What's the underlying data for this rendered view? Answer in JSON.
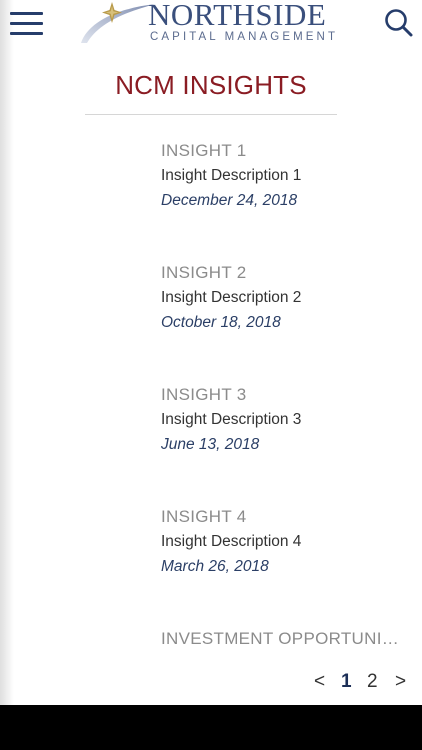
{
  "header": {
    "logo_name": "NORTHSIDE",
    "logo_subtitle": "CAPITAL MANAGEMENT",
    "menu_icon": "hamburger-menu-icon",
    "search_icon": "search-icon",
    "brand_color": "#263d6b"
  },
  "page": {
    "title": "NCM INSIGHTS",
    "title_color": "#8a1c23"
  },
  "insights": [
    {
      "title": "INSIGHT 1",
      "description": "Insight Description 1",
      "date": "December 24, 2018"
    },
    {
      "title": "INSIGHT 2",
      "description": "Insight Description 2",
      "date": "October 18, 2018"
    },
    {
      "title": "INSIGHT 3",
      "description": "Insight Description 3",
      "date": "June 13, 2018"
    },
    {
      "title": "INSIGHT 4",
      "description": "Insight Description 4",
      "date": "March 26, 2018"
    },
    {
      "title": "INVESTMENT OPPORTUNITIES"
    }
  ],
  "pagination": {
    "prev": "<",
    "pages": [
      "1",
      "2"
    ],
    "current": "1",
    "next": ">"
  }
}
